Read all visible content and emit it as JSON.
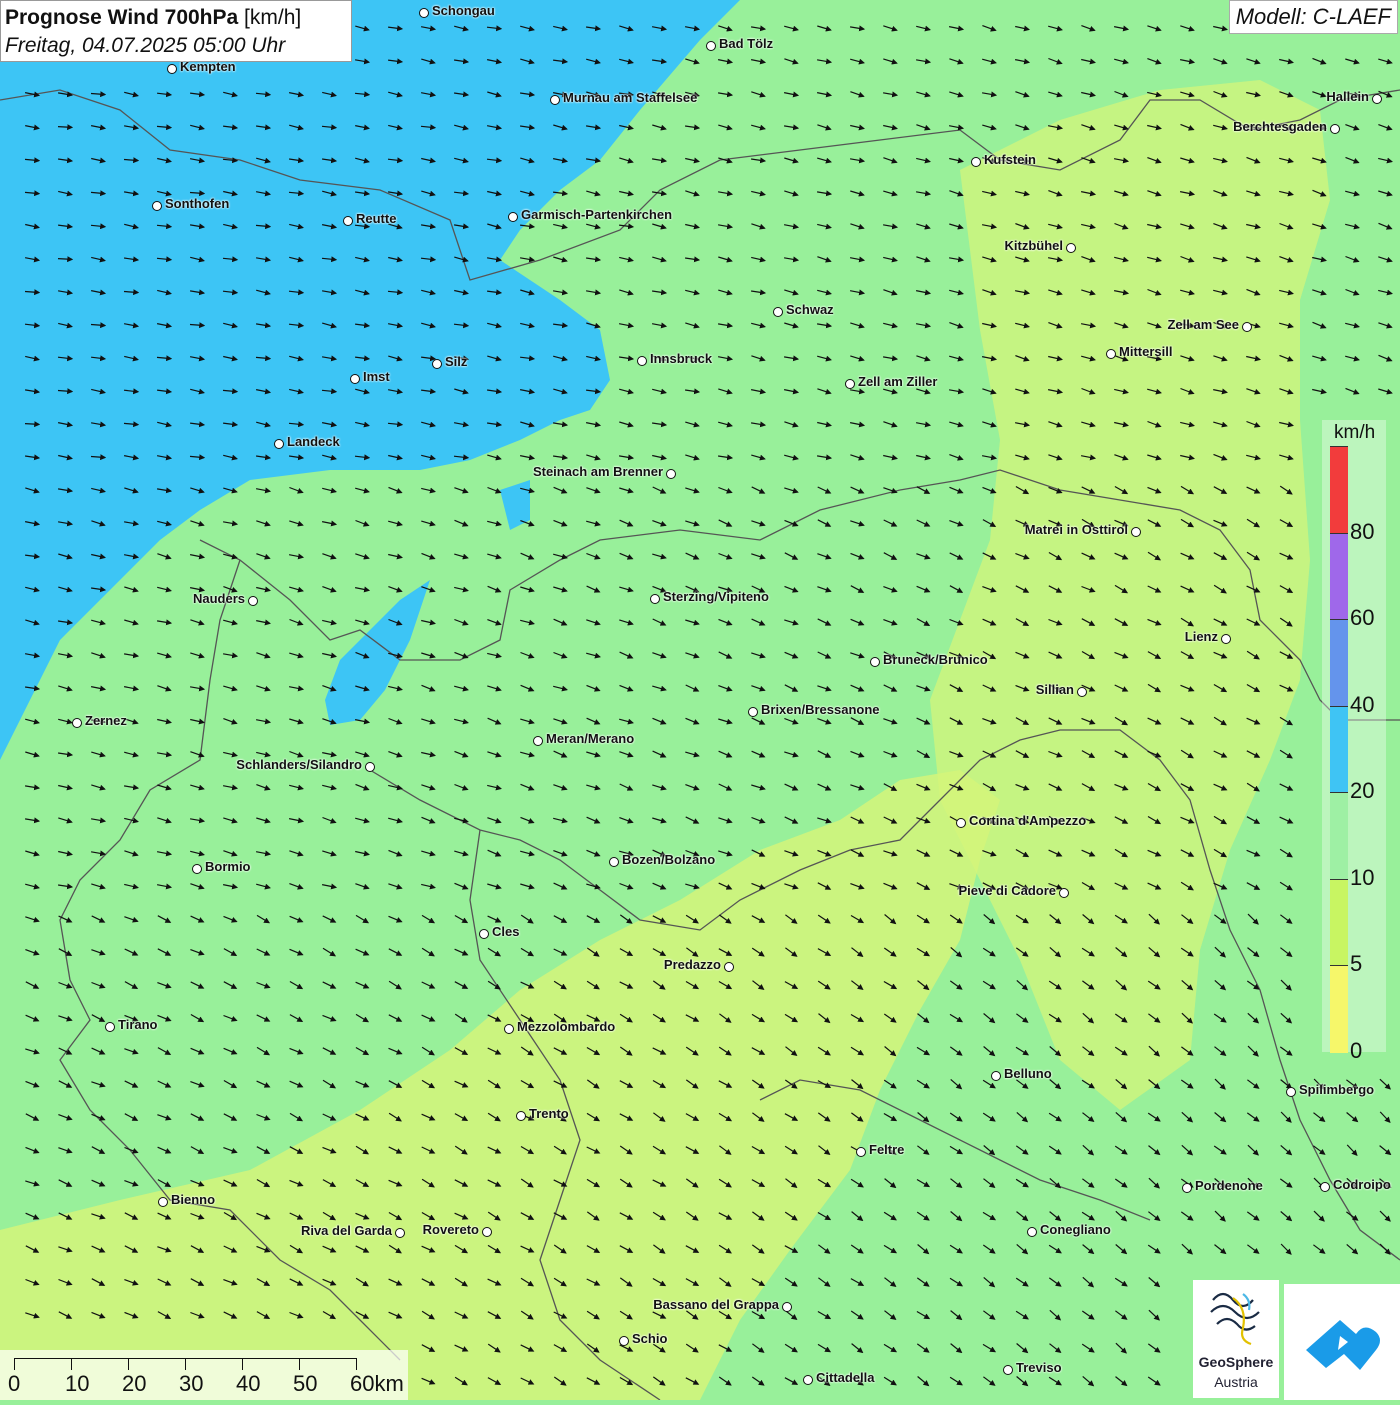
{
  "title": {
    "main": "Prognose Wind 700hPa",
    "unit": "[km/h]",
    "date": "Freitag, 04.07.2025 05:00 Uhr"
  },
  "model": "Modell: C-LAEF",
  "colors": {
    "land_green": "#98f09a",
    "blue_zone": "#3dc5f5",
    "yellow_zone": "#d9f57a",
    "border": "#555555",
    "lake": "#58c8f0"
  },
  "legend": {
    "unit": "km/h",
    "bands": [
      {
        "color": "#f23c3c"
      },
      {
        "color": "#9f68ea"
      },
      {
        "color": "#6494ec"
      },
      {
        "color": "#3fc4f4"
      },
      {
        "color": "#9ef0a4"
      },
      {
        "color": "#c8f562"
      },
      {
        "color": "#f6f76a"
      }
    ],
    "labels": [
      "80",
      "60",
      "40",
      "20",
      "10",
      "5",
      "0"
    ]
  },
  "scale_bar": {
    "labels": [
      "0",
      "10",
      "20",
      "30",
      "40",
      "50",
      "60km"
    ]
  },
  "logos": {
    "geosphere_line1": "GeoSphere",
    "geosphere_line2": "Austria"
  },
  "cities": [
    {
      "name": "Schongau"
    },
    {
      "name": "Bad Tölz"
    },
    {
      "name": "Kempten"
    },
    {
      "name": "Murnau am Staffelsee"
    },
    {
      "name": "Hallein"
    },
    {
      "name": "Berchtesgaden"
    },
    {
      "name": "Kufstein"
    },
    {
      "name": "Sonthofen"
    },
    {
      "name": "Reutte"
    },
    {
      "name": "Garmisch-Partenkirchen"
    },
    {
      "name": "Kitzbühel"
    },
    {
      "name": "Schwaz"
    },
    {
      "name": "Zell am See"
    },
    {
      "name": "Mittersill"
    },
    {
      "name": "Innsbruck"
    },
    {
      "name": "Silz"
    },
    {
      "name": "Imst"
    },
    {
      "name": "Zell am Ziller"
    },
    {
      "name": "Landeck"
    },
    {
      "name": "Steinach am Brenner"
    },
    {
      "name": "Matrei in Osttirol"
    },
    {
      "name": "Nauders"
    },
    {
      "name": "Sterzing/Vipiteno"
    },
    {
      "name": "Lienz"
    },
    {
      "name": "Bruneck/Brunico"
    },
    {
      "name": "Sillian"
    },
    {
      "name": "Brixen/Bressanone"
    },
    {
      "name": "Zernez"
    },
    {
      "name": "Meran/Merano"
    },
    {
      "name": "Schlanders/Silandro"
    },
    {
      "name": "Cortina d'Ampezzo"
    },
    {
      "name": "Bozen/Bolzano"
    },
    {
      "name": "Bormio"
    },
    {
      "name": "Pieve di Cadore"
    },
    {
      "name": "Cles"
    },
    {
      "name": "Predazzo"
    },
    {
      "name": "Tirano"
    },
    {
      "name": "Mezzolombardo"
    },
    {
      "name": "Belluno"
    },
    {
      "name": "Spilimbergo"
    },
    {
      "name": "Trento"
    },
    {
      "name": "Feltre"
    },
    {
      "name": "Pordenone"
    },
    {
      "name": "Codroipo"
    },
    {
      "name": "Bienno"
    },
    {
      "name": "Riva del Garda"
    },
    {
      "name": "Rovereto"
    },
    {
      "name": "Conegliano"
    },
    {
      "name": "Bassano del Grappa"
    },
    {
      "name": "Schio"
    },
    {
      "name": "Treviso"
    },
    {
      "name": "Cittadella"
    }
  ]
}
